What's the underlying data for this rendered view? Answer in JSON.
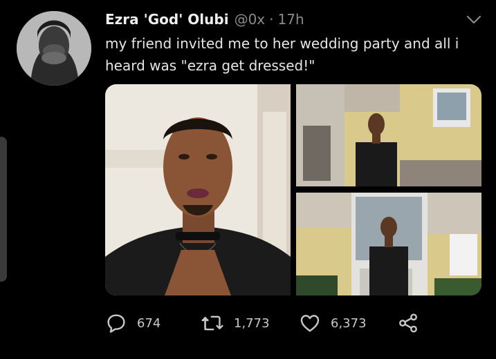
{
  "tweet": {
    "display_name": "Ezra 'God' Olubi",
    "handle": "@0x",
    "separator": "·",
    "time": "17h",
    "text": "my friend invited me to her wedding party and all i heard was \"ezra get dressed!\"",
    "actions": {
      "replies": "674",
      "retweets": "1,773",
      "likes": "6,373"
    }
  },
  "icons": [
    "chevron-down-icon",
    "reply-icon",
    "retweet-icon",
    "like-icon",
    "share-icon"
  ],
  "colors": {
    "background": "#000000",
    "text": "#e6e6e6",
    "muted": "#8b8b8b"
  }
}
